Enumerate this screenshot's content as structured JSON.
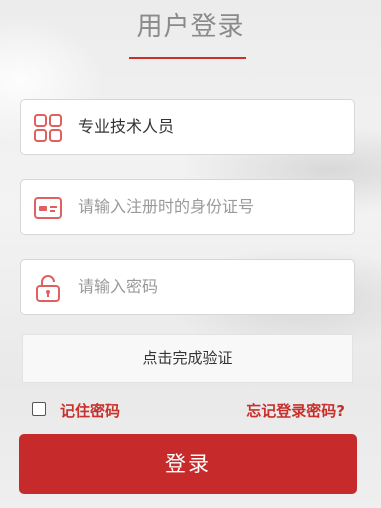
{
  "header": {
    "title": "用户登录"
  },
  "form": {
    "user_type": {
      "value": "专业技术人员",
      "icon": "grid-icon"
    },
    "id_field": {
      "placeholder": "请输入注册时的身份证号",
      "icon": "id-card-icon"
    },
    "password_field": {
      "placeholder": "请输入密码",
      "icon": "lock-icon"
    },
    "verify_label": "点击完成验证",
    "remember_label": "记住密码",
    "forgot_label": "忘记登录密码?",
    "login_label": "登录"
  },
  "colors": {
    "accent": "#c62a2a",
    "icon": "#e06060",
    "title": "#8a8a8a"
  }
}
